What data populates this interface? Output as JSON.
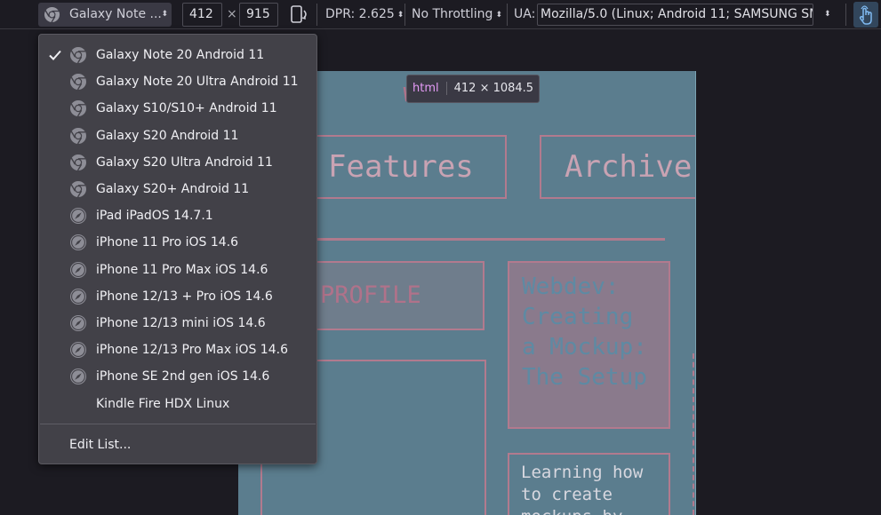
{
  "toolbar": {
    "device_selected": "Galaxy Note ...",
    "width": "412",
    "times": "×",
    "height": "915",
    "dpr": "DPR: 2.625",
    "throttling": "No Throttling",
    "ua_label": "UA:",
    "ua_value": "Mozilla/5.0 (Linux; Android 11; SAMSUNG SM-"
  },
  "tooltip": {
    "tag": "html",
    "dims": "412 × 1084.5"
  },
  "page": {
    "welcome": "WELCOME",
    "nav_features": "Features",
    "nav_archive": "Archive",
    "profile": "PROFILE",
    "webdev_lines": [
      "Webdev:",
      "Creating",
      "a Mockup:",
      "The Setup"
    ],
    "learn_lines": [
      "Learning how",
      "to create",
      "mockups by"
    ]
  },
  "device_menu": {
    "items": [
      {
        "label": "Galaxy Note 20 Android 11",
        "icon": "chrome-icon",
        "checked": true
      },
      {
        "label": "Galaxy Note 20 Ultra Android 11",
        "icon": "chrome-icon",
        "checked": false
      },
      {
        "label": "Galaxy S10/S10+ Android 11",
        "icon": "chrome-icon",
        "checked": false
      },
      {
        "label": "Galaxy S20 Android 11",
        "icon": "chrome-icon",
        "checked": false
      },
      {
        "label": "Galaxy S20 Ultra Android 11",
        "icon": "chrome-icon",
        "checked": false
      },
      {
        "label": "Galaxy S20+ Android 11",
        "icon": "chrome-icon",
        "checked": false
      },
      {
        "label": "iPad iPadOS 14.7.1",
        "icon": "safari-icon",
        "checked": false
      },
      {
        "label": "iPhone 11 Pro iOS 14.6",
        "icon": "safari-icon",
        "checked": false
      },
      {
        "label": "iPhone 11 Pro Max iOS 14.6",
        "icon": "safari-icon",
        "checked": false
      },
      {
        "label": "iPhone 12/13 + Pro iOS 14.6",
        "icon": "safari-icon",
        "checked": false
      },
      {
        "label": "iPhone 12/13 mini iOS 14.6",
        "icon": "safari-icon",
        "checked": false
      },
      {
        "label": "iPhone 12/13 Pro Max iOS 14.6",
        "icon": "safari-icon",
        "checked": false
      },
      {
        "label": "iPhone SE 2nd gen iOS 14.6",
        "icon": "safari-icon",
        "checked": false
      },
      {
        "label": "Kindle Fire HDX Linux",
        "icon": "",
        "checked": false
      }
    ],
    "edit_list": "Edit List..."
  }
}
